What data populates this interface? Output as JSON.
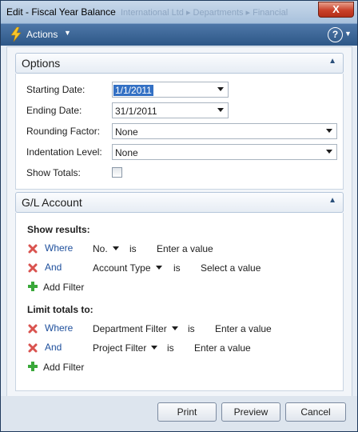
{
  "window": {
    "title": "Edit - Fiscal Year Balance",
    "background_title": "International Ltd  ▸  Departments  ▸  Financial",
    "close_label": "X"
  },
  "actions": {
    "label": "Actions",
    "help_label": "?"
  },
  "options": {
    "header": "Options",
    "starting_date_label": "Starting Date:",
    "starting_date_value": "1/1/2011",
    "ending_date_label": "Ending Date:",
    "ending_date_value": "31/1/2011",
    "rounding_factor_label": "Rounding Factor:",
    "rounding_factor_value": "None",
    "indentation_level_label": "Indentation Level:",
    "indentation_level_value": "None",
    "show_totals_label": "Show Totals:",
    "show_totals_checked": false
  },
  "gl_account": {
    "header": "G/L Account",
    "show_results": {
      "label": "Show results:",
      "filters": [
        {
          "connector": "Where",
          "field": "No.",
          "operator": "is",
          "value": "Enter a value"
        },
        {
          "connector": "And",
          "field": "Account Type",
          "operator": "is",
          "value": "Select a value"
        }
      ],
      "add_filter": "Add Filter"
    },
    "limit_totals": {
      "label": "Limit totals to:",
      "filters": [
        {
          "connector": "Where",
          "field": "Department Filter",
          "operator": "is",
          "value": "Enter a value"
        },
        {
          "connector": "And",
          "field": "Project Filter",
          "operator": "is",
          "value": "Enter a value"
        }
      ],
      "add_filter": "Add Filter"
    }
  },
  "footer": {
    "print": "Print",
    "preview": "Preview",
    "cancel": "Cancel"
  },
  "colors": {
    "action_bar": "#2d5787",
    "link_blue": "#1e4f9c",
    "selection": "#3370c4"
  }
}
